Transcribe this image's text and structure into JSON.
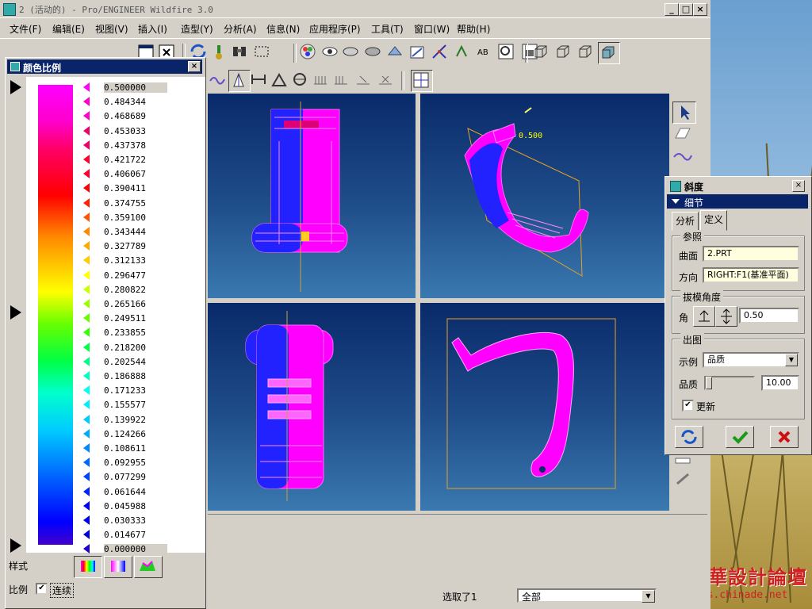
{
  "window": {
    "title": "2 (活动的) - Pro/ENGINEER Wildfire 3.0",
    "min_label": "_",
    "max_label": "□",
    "close_label": "×"
  },
  "menu": [
    {
      "label": "文件(F)"
    },
    {
      "label": "编辑(E)"
    },
    {
      "label": "视图(V)"
    },
    {
      "label": "插入(I)"
    },
    {
      "label": "造型(Y)"
    },
    {
      "label": "分析(A)"
    },
    {
      "label": "信息(N)"
    },
    {
      "label": "应用程序(P)"
    },
    {
      "label": "工具(T)"
    },
    {
      "label": "窗口(W)"
    },
    {
      "label": "帮助(H)"
    }
  ],
  "scale_panel": {
    "title": "颜色比例",
    "close_label": "×",
    "values": [
      "0.500000",
      "0.484344",
      "0.468689",
      "0.453033",
      "0.437378",
      "0.421722",
      "0.406067",
      "0.390411",
      "0.374755",
      "0.359100",
      "0.343444",
      "0.327789",
      "0.312133",
      "0.296477",
      "0.280822",
      "0.265166",
      "0.249511",
      "0.233855",
      "0.218200",
      "0.202544",
      "0.186888",
      "0.171233",
      "0.155577",
      "0.139922",
      "0.124266",
      "0.108611",
      "0.092955",
      "0.077299",
      "0.061644",
      "0.045988",
      "0.030333",
      "0.014677",
      "0.000000"
    ],
    "style_label": "样式",
    "ratio_label": "比例",
    "continuous_label": "连续",
    "continuous_checked": "✔"
  },
  "draft_dialog": {
    "title": "斜度",
    "close_label": "×",
    "detail_label": "细节",
    "tabs": [
      {
        "label": "分析"
      },
      {
        "label": "定义"
      }
    ],
    "reference_group": "参照",
    "surface_label": "曲面",
    "surface_value": "2.PRT",
    "direction_label": "方向",
    "direction_value": "RIGHT:F1(基准平面)",
    "draft_angle_group": "拔模角度",
    "angle_label": "角",
    "angle_value": "0.50",
    "output_group": "出图",
    "sample_label": "示例",
    "sample_value": "品质",
    "quality_label": "品质",
    "quality_value": "10.00",
    "quality_fraction": 0.0,
    "update_label": "更新",
    "update_checked": "✔"
  },
  "viewport_annotation": "0.500",
  "status": {
    "selected_text": "选取了1",
    "filter_value": "全部"
  },
  "watermark": {
    "line1": "中華設計論壇",
    "line2": "bbs.chinade.net"
  },
  "colors": {
    "title_active": "#0a246a",
    "model": "#ff00ff",
    "model_blue": "#2222ff",
    "ok_green": "#1a9a1a",
    "cancel_red": "#cc1010"
  }
}
